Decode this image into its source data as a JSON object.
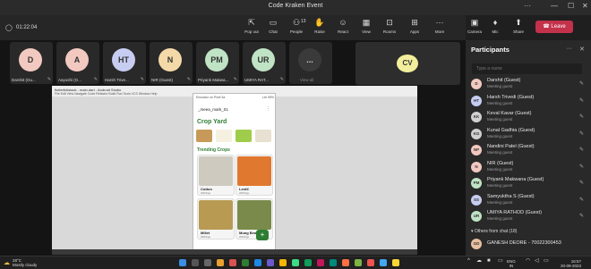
{
  "window": {
    "title": "Code Kraken Event"
  },
  "meeting": {
    "timer": "01:22:04"
  },
  "toolbar": {
    "items": [
      {
        "label": "Pop out",
        "icon": "pop-out-icon"
      },
      {
        "label": "Chat",
        "icon": "chat-icon"
      },
      {
        "label": "People",
        "icon": "people-icon",
        "badge": "13"
      },
      {
        "label": "Raise",
        "icon": "hand-icon"
      },
      {
        "label": "React",
        "icon": "smile-icon"
      },
      {
        "label": "View",
        "icon": "view-icon"
      },
      {
        "label": "Rooms",
        "icon": "rooms-icon"
      },
      {
        "label": "Apps",
        "icon": "apps-icon"
      },
      {
        "label": "More",
        "icon": "more-icon"
      }
    ],
    "camera": "Camera",
    "mic": "Mic",
    "share": "Share",
    "leave": "Leave"
  },
  "tiles": [
    {
      "initials": "D",
      "name": "Darshit (Gu...",
      "color": "#f2c9c0"
    },
    {
      "initials": "A",
      "name": "Aayushi (G...",
      "color": "#f2c9c0"
    },
    {
      "initials": "HT",
      "name": "Harsh Trive...",
      "color": "#c7cdf0"
    },
    {
      "initials": "N",
      "name": "NIR (Guest)",
      "color": "#f4d9a8"
    },
    {
      "initials": "PM",
      "name": "Priyank Makwa...",
      "color": "#bfe3c4"
    },
    {
      "initials": "UR",
      "name": "UMIYA RAT...",
      "color": "#bfe3c4"
    },
    {
      "initials": "...",
      "name": "View all",
      "color": "#3a3a3a"
    }
  ],
  "spotlight": {
    "initials": "CV"
  },
  "shared_screen": {
    "window_title": "flutterfullstack - main.dart - Android Studio",
    "menu": "File  Edit  View  Navigate  Code  Refactor  Build  Run  Tools  VCS  Window  Help",
    "phone": {
      "status_left": "Emulator on Pixel 3a",
      "status_right": "Lte 95%",
      "username": "_meea_mark_01",
      "brand": "Crop Yard",
      "section": "Trending Crops",
      "crops": [
        {
          "name": "Cotton",
          "price": "200/Kgs",
          "color": "#cfcac0"
        },
        {
          "name": "Lentil",
          "price": "200/Kgs",
          "color": "#e0782f"
        },
        {
          "name": "Millet",
          "price": "200/Kgs",
          "color": "#b89a52"
        },
        {
          "name": "Mung Beans",
          "price": "200/Kgs",
          "color": "#7a8a4a"
        }
      ],
      "fab": "+"
    }
  },
  "participants": {
    "title": "Participants",
    "search_placeholder": "Type a name",
    "list": [
      {
        "initials": "D",
        "name": "Darshit (Guest)",
        "role": "Meeting guest",
        "color": "#f2c9c0"
      },
      {
        "initials": "HT",
        "name": "Harsh Trivedi (Guest)",
        "role": "Meeting guest",
        "color": "#c7cdf0"
      },
      {
        "initials": "KK",
        "name": "Keval Kavar (Guest)",
        "role": "Meeting guest",
        "color": "#d0d0d0"
      },
      {
        "initials": "KG",
        "name": "Kunal Gadhia (Guest)",
        "role": "Meeting guest",
        "color": "#d0d0d0"
      },
      {
        "initials": "NP",
        "name": "Nandini Patel (Guest)",
        "role": "Meeting guest",
        "color": "#f2c9c0"
      },
      {
        "initials": "N",
        "name": "NIR (Guest)",
        "role": "Meeting guest",
        "color": "#f2c9c0"
      },
      {
        "initials": "PM",
        "name": "Priyank Makwana (Guest)",
        "role": "Meeting guest",
        "color": "#bfe3c4"
      },
      {
        "initials": "SS",
        "name": "Samyuktha S (Guest)",
        "role": "Meeting guest",
        "color": "#c7cdf0"
      },
      {
        "initials": "UR",
        "name": "UMIYA RATHOD (Guest)",
        "role": "Meeting guest",
        "color": "#bfe3c4"
      }
    ],
    "others_label": "Others from chat (18)",
    "chat_user": {
      "initials": "GD",
      "name": "GANESH DEORE - 70022300453",
      "color": "#e8c0a0"
    }
  },
  "taskbar": {
    "weather_temp": "28°C",
    "weather_desc": "Mostly cloudy",
    "lang": "ENG",
    "region": "IN",
    "time": "16:5?",
    "date": "20-09-2023"
  }
}
